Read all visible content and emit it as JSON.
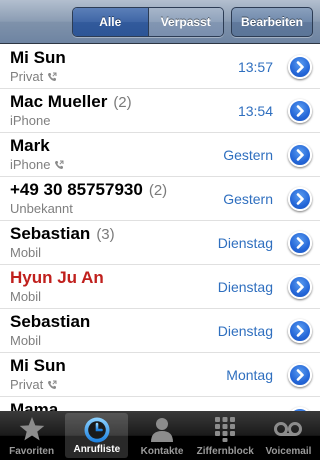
{
  "header": {
    "segments": [
      {
        "label": "Alle",
        "active": true
      },
      {
        "label": "Verpasst",
        "active": false
      }
    ],
    "edit_label": "Bearbeiten"
  },
  "calls": [
    {
      "name": "Mi Sun",
      "count": "",
      "type": "Privat",
      "phone_icon": true,
      "time": "13:57",
      "missed": false
    },
    {
      "name": "Mac Mueller",
      "count": "(2)",
      "type": "iPhone",
      "phone_icon": false,
      "time": "13:54",
      "missed": false
    },
    {
      "name": "Mark",
      "count": "",
      "type": "iPhone",
      "phone_icon": true,
      "time": "Gestern",
      "missed": false
    },
    {
      "name": "+49 30 85757930",
      "count": "(2)",
      "type": "Unbekannt",
      "phone_icon": false,
      "time": "Gestern",
      "missed": false
    },
    {
      "name": "Sebastian",
      "count": "(3)",
      "type": "Mobil",
      "phone_icon": false,
      "time": "Dienstag",
      "missed": false
    },
    {
      "name": "Hyun Ju An",
      "count": "",
      "type": "Mobil",
      "phone_icon": false,
      "time": "Dienstag",
      "missed": true
    },
    {
      "name": "Sebastian",
      "count": "",
      "type": "Mobil",
      "phone_icon": false,
      "time": "Dienstag",
      "missed": false
    },
    {
      "name": "Mi Sun",
      "count": "",
      "type": "Privat",
      "phone_icon": true,
      "time": "Montag",
      "missed": false
    },
    {
      "name": "Mama",
      "count": "",
      "type": "",
      "phone_icon": false,
      "time": "",
      "missed": false
    }
  ],
  "tabs": [
    {
      "label": "Favoriten",
      "icon": "star-icon",
      "active": false
    },
    {
      "label": "Anrufliste",
      "icon": "clock-icon",
      "active": true
    },
    {
      "label": "Kontakte",
      "icon": "person-icon",
      "active": false
    },
    {
      "label": "Ziffernblock",
      "icon": "keypad-icon",
      "active": false
    },
    {
      "label": "Voicemail",
      "icon": "voicemail-icon",
      "active": false
    }
  ],
  "colors": {
    "missed_call": "#c0201d",
    "time_text": "#2f6fbf",
    "disclosure": "#2567d8"
  }
}
